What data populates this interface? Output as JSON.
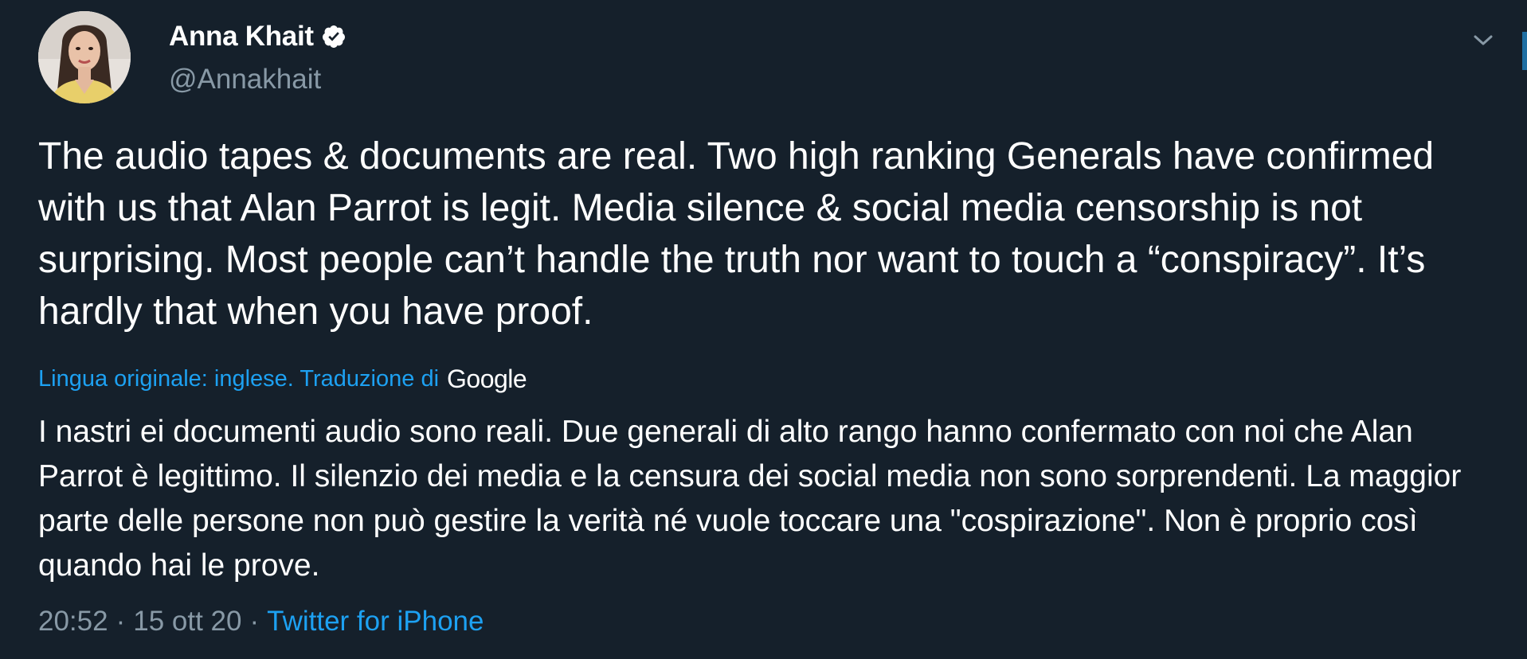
{
  "user": {
    "display_name": "Anna Khait",
    "handle": "@Annakhait",
    "verified": true
  },
  "tweet": {
    "text": "The audio tapes & documents are real. Two high ranking Generals have confirmed with us that Alan Parrot is legit. Media silence & social media censorship is not surprising. Most people can’t handle the truth nor want to touch a “conspiracy”. It’s hardly that when you have proof.",
    "translation_label": "Lingua originale: inglese. Traduzione di",
    "translation_provider": "Google",
    "translated_text": "I nastri ei documenti audio sono reali. Due generali di alto rango hanno confermato con noi che Alan Parrot è legittimo. Il silenzio dei media e la censura dei social media non sono sorprendenti. La maggior parte delle persone non può gestire la verità né vuole toccare una \"cospirazione\". Non è proprio così quando hai le prove.",
    "time": "20:52",
    "date": "15 ott 20",
    "separator": "·",
    "source": "Twitter for iPhone"
  },
  "icons": {
    "verified": "verified-badge-icon",
    "menu": "chevron-down-icon"
  },
  "colors": {
    "background": "#15202b",
    "accent": "#1da1f2",
    "secondary_text": "#8899a6",
    "primary_text": "#ffffff"
  }
}
